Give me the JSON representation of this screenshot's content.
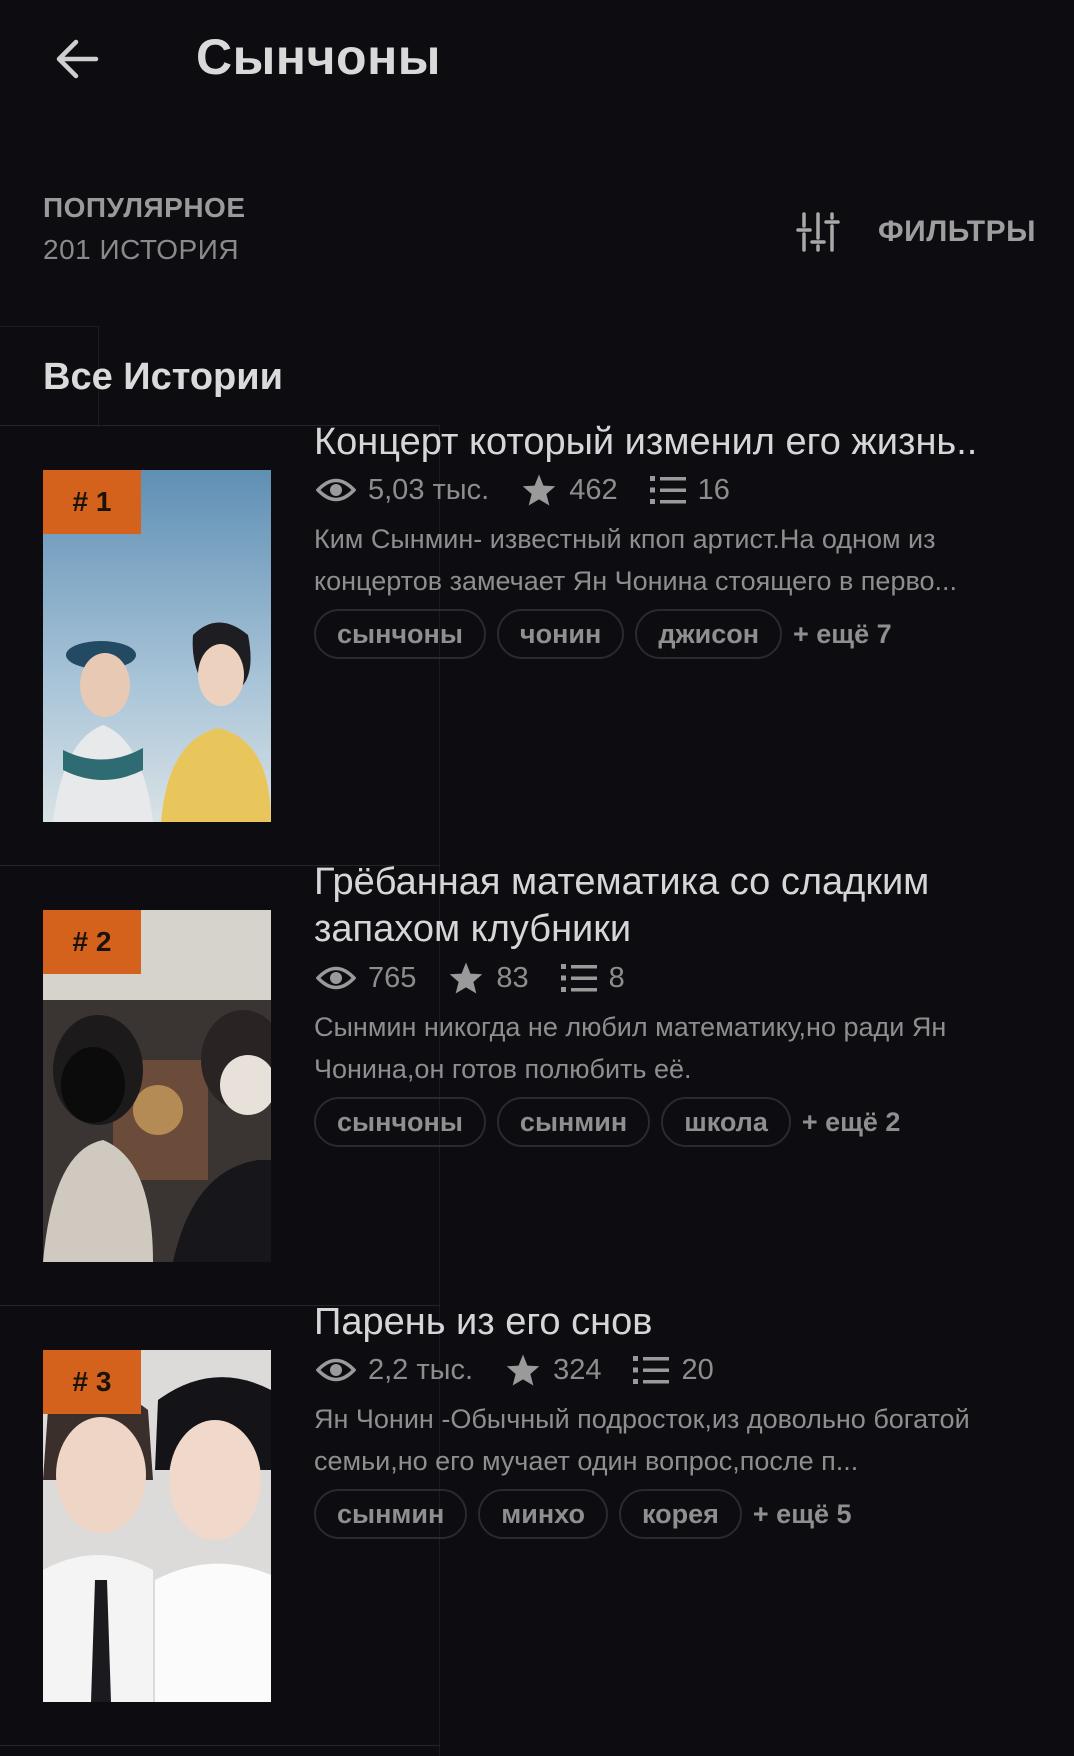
{
  "header": {
    "title": "Сынчоны",
    "back_icon": "arrow-left-icon"
  },
  "sort": {
    "label": "ПОПУЛЯРНОЕ",
    "count": "201 ИСТОРИЯ"
  },
  "filter": {
    "label": "ФИЛЬТРЫ",
    "icon": "sliders-icon"
  },
  "section": {
    "title": "Все Истории"
  },
  "colors": {
    "background": "#0d0c10",
    "accent": "#d4611c",
    "text": "#d6d6d6",
    "muted": "#8e8e8e"
  },
  "stories": [
    {
      "rank": "# 1",
      "title": "Концерт который изменил его жизнь..",
      "views": "5,03 тыс.",
      "votes": "462",
      "parts": "16",
      "description": "Ким Сынмин- известный кпоп артист.На одном из концертов замечает Ян Чонина стоящего в перво...",
      "tags": [
        "сынчоны",
        "чонин",
        "джисон"
      ],
      "more_tags": "+ ещё 7"
    },
    {
      "rank": "# 2",
      "title": "Грёбанная математика со сладким запахом клубники",
      "views": "765",
      "votes": "83",
      "parts": "8",
      "description": "Сынмин никогда не любил математику,но ради Ян Чонина,он готов полюбить её.",
      "tags": [
        "сынчоны",
        "сынмин",
        "школа"
      ],
      "more_tags": "+ ещё 2"
    },
    {
      "rank": "# 3",
      "title": "Парень из его снов",
      "views": "2,2 тыс.",
      "votes": "324",
      "parts": "20",
      "description": "Ян Чонин -Обычный подросток,из довольно богатой семьи,но его мучает один вопрос,после п...",
      "tags": [
        "сынмин",
        "минхо",
        "корея"
      ],
      "more_tags": "+ ещё 5"
    }
  ]
}
